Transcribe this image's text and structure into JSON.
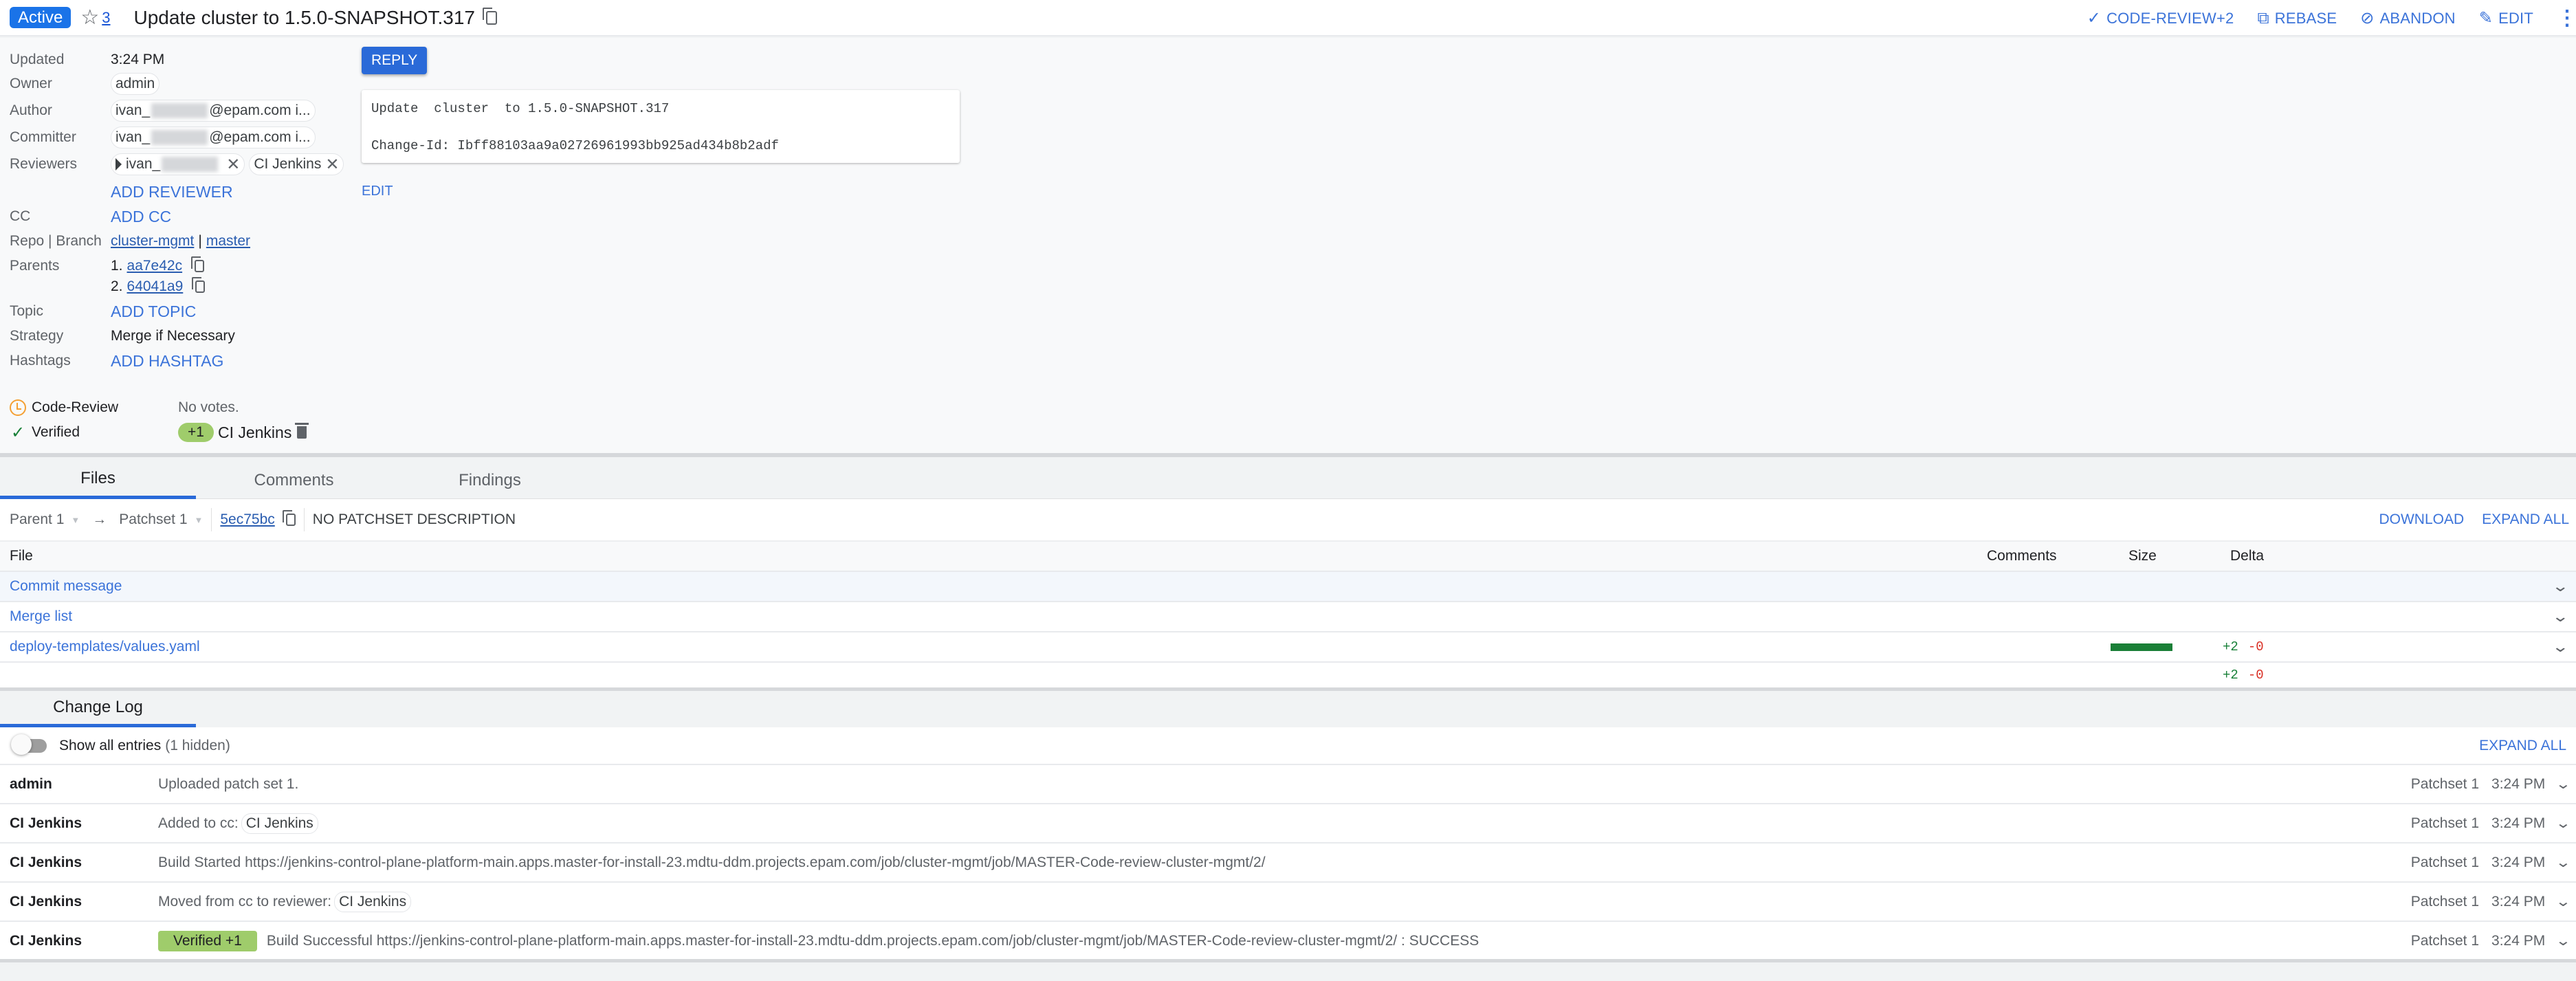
{
  "header": {
    "status": "Active",
    "star_icon": "star-outline-icon",
    "star_count": "3",
    "title": "Update cluster to 1.5.0-SNAPSHOT.317",
    "actions": [
      {
        "icon": "check-icon",
        "glyph": "✓",
        "label": "CODE-REVIEW+2"
      },
      {
        "icon": "rebase-icon",
        "glyph": "⧉",
        "label": "REBASE"
      },
      {
        "icon": "abandon-icon",
        "glyph": "⊘",
        "label": "ABANDON"
      },
      {
        "icon": "pencil-icon",
        "glyph": "✎",
        "label": "EDIT"
      }
    ],
    "more_icon": "⋮"
  },
  "metadata": {
    "updated_label": "Updated",
    "updated_value": "3:24 PM",
    "owner_label": "Owner",
    "owner_value": "admin",
    "author_label": "Author",
    "author_prefix": "ivan_",
    "author_suffix": "@epam.com i...",
    "committer_label": "Committer",
    "committer_prefix": "ivan_",
    "committer_suffix": "@epam.com i...",
    "reviewers_label": "Reviewers",
    "reviewers": [
      {
        "prefix": "ivan_",
        "remove": "✕"
      },
      {
        "name": "CI Jenkins",
        "remove": "✕"
      }
    ],
    "add_reviewer": "ADD REVIEWER",
    "cc_label": "CC",
    "add_cc": "ADD CC",
    "repo_label": "Repo | Branch",
    "repo": "cluster-mgmt",
    "repo_sep": "|",
    "branch": "master",
    "parents_label": "Parents",
    "parents": [
      {
        "index": "1.",
        "hash": "aa7e42c"
      },
      {
        "index": "2.",
        "hash": "64041a9"
      }
    ],
    "topic_label": "Topic",
    "add_topic": "ADD TOPIC",
    "strategy_label": "Strategy",
    "strategy_value": "Merge if Necessary",
    "hashtags_label": "Hashtags",
    "add_hashtag": "ADD HASHTAG"
  },
  "commit": {
    "reply_label": "REPLY",
    "message": "Update  cluster  to 1.5.0-SNAPSHOT.317\n\nChange-Id: Ibff88103aa9a02726961993bb925ad434b8b2adf",
    "edit_label": "EDIT"
  },
  "votes": [
    {
      "label": "Code-Review",
      "status_icon": "clock-icon",
      "value": "No votes."
    },
    {
      "label": "Verified",
      "status_icon": "check-icon",
      "chip": "+1",
      "voter": "CI Jenkins"
    }
  ],
  "files_tabs": [
    "Files",
    "Comments",
    "Findings"
  ],
  "patchset": {
    "base": "Parent 1",
    "arrow": "→",
    "target": "Patchset 1",
    "commit": "5ec75bc",
    "description": "NO PATCHSET DESCRIPTION",
    "download": "DOWNLOAD",
    "expand_all": "EXPAND ALL"
  },
  "file_table": {
    "columns": {
      "file": "File",
      "comments": "Comments",
      "size": "Size",
      "delta": "Delta"
    },
    "rows": [
      {
        "name": "Commit message",
        "size_fraction": null,
        "added": "",
        "removed": ""
      },
      {
        "name": "Merge list",
        "size_fraction": null,
        "added": "",
        "removed": ""
      },
      {
        "name": "deploy-templates/values.yaml",
        "size_fraction": 1.0,
        "added": "+2",
        "removed": "-0"
      }
    ],
    "totals": {
      "added": "+2",
      "removed": "-0"
    },
    "chevron": "⌄"
  },
  "change_log": {
    "tab_label": "Change Log",
    "toggle_label": "Show all entries",
    "hidden_count": "(1 hidden)",
    "expand_all": "EXPAND ALL",
    "entries": [
      {
        "author": "admin",
        "label_chip": "",
        "message": "Uploaded patch set 1.",
        "chip": "",
        "patchset": "Patchset 1",
        "time": "3:24 PM"
      },
      {
        "author": "CI Jenkins",
        "label_chip": "",
        "message": "Added to cc:",
        "chip": "CI Jenkins",
        "patchset": "Patchset 1",
        "time": "3:24 PM"
      },
      {
        "author": "CI Jenkins",
        "label_chip": "",
        "message": "Build Started https://jenkins-control-plane-platform-main.apps.master-for-install-23.mdtu-ddm.projects.epam.com/job/cluster-mgmt/job/MASTER-Code-review-cluster-mgmt/2/",
        "chip": "",
        "patchset": "Patchset 1",
        "time": "3:24 PM"
      },
      {
        "author": "CI Jenkins",
        "label_chip": "",
        "message": "Moved from cc to reviewer:",
        "chip": "CI Jenkins",
        "patchset": "Patchset 1",
        "time": "3:24 PM"
      },
      {
        "author": "CI Jenkins",
        "label_chip": "Verified +1",
        "message": "Build Successful https://jenkins-control-plane-platform-main.apps.master-for-install-23.mdtu-ddm.projects.epam.com/job/cluster-mgmt/job/MASTER-Code-review-cluster-mgmt/2/ : SUCCESS",
        "chip": "",
        "patchset": "Patchset 1",
        "time": "3:24 PM"
      }
    ]
  },
  "colors": {
    "accent": "#1a73e8",
    "link": "#3b73d9",
    "vote_positive": "#9fcc6b",
    "delta_add": "#188038",
    "delta_del": "#d93025"
  }
}
